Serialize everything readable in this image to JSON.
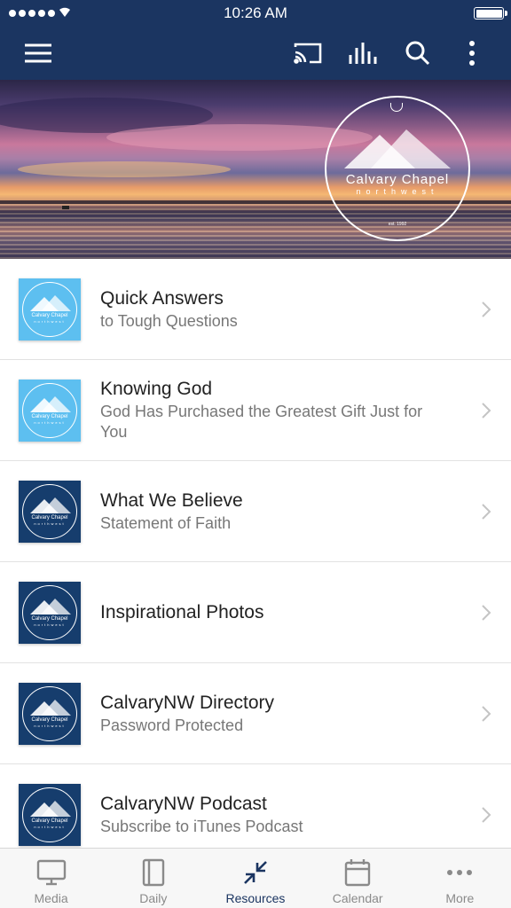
{
  "status_bar": {
    "time": "10:26 AM"
  },
  "banner": {
    "logo_name": "Calvary Chapel",
    "logo_sub": "northwest",
    "logo_est": "est. 1992"
  },
  "thumb": {
    "name": "Calvary Chapel",
    "sub": "northwest"
  },
  "items": [
    {
      "title": "Quick Answers",
      "subtitle": "to Tough Questions",
      "style": "light"
    },
    {
      "title": "Knowing God",
      "subtitle": "God Has Purchased the Greatest Gift Just for You",
      "style": "light"
    },
    {
      "title": "What We Believe",
      "subtitle": "Statement of Faith",
      "style": "dark"
    },
    {
      "title": "Inspirational Photos",
      "subtitle": "",
      "style": "dark"
    },
    {
      "title": "CalvaryNW Directory",
      "subtitle": "Password Protected",
      "style": "dark"
    },
    {
      "title": "CalvaryNW Podcast",
      "subtitle": "Subscribe to iTunes Podcast",
      "style": "dark"
    }
  ],
  "tabs": [
    {
      "label": "Media",
      "icon": "monitor-icon"
    },
    {
      "label": "Daily",
      "icon": "book-icon"
    },
    {
      "label": "Resources",
      "icon": "resources-icon"
    },
    {
      "label": "Calendar",
      "icon": "calendar-icon"
    },
    {
      "label": "More",
      "icon": "more-icon"
    }
  ],
  "colors": {
    "nav": "#1b3561",
    "tab_active": "#1b3561",
    "tab_inactive": "#8a8a8a",
    "thumb_light": "#5dbff0",
    "thumb_dark": "#163d6d"
  }
}
